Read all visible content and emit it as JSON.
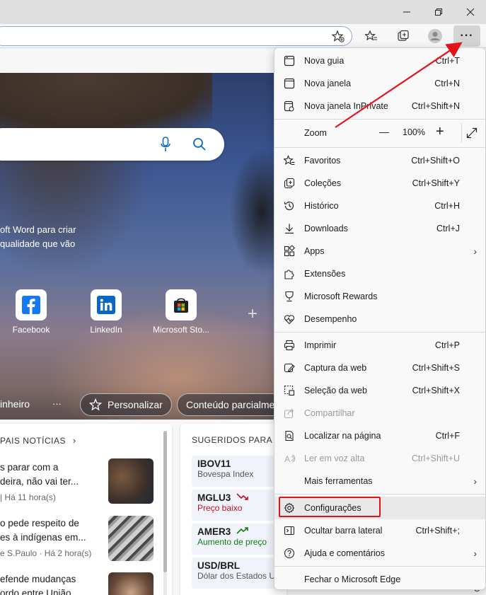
{
  "window": {
    "minimize": "—",
    "maximize": "❐",
    "close": "✕"
  },
  "page": {
    "promo_lines": [
      "oft Word para criar",
      "qualidade que vão"
    ],
    "quick_links": [
      {
        "label": "Facebook",
        "icon": "facebook-icon"
      },
      {
        "label": "LinkedIn",
        "icon": "linkedin-icon"
      },
      {
        "label": "Microsoft Sto...",
        "icon": "microsoft-store-icon"
      }
    ],
    "add_quick_link": "+",
    "feed_bar": {
      "tab_money": "inheiro",
      "ellipsis": "···",
      "personalize": "Personalizar",
      "content": "Conteúdo parcialme"
    },
    "news": {
      "header": "PAIS NOTÍCIAS",
      "items": [
        {
          "lines": [
            "s parar com a",
            "deira, não vai ter..."
          ],
          "meta": "| Há 11 hora(s)"
        },
        {
          "lines": [
            "o pede respeito de",
            "es à indígenas em..."
          ],
          "meta": "e S.Paulo · Há 2 hora(s)"
        },
        {
          "lines": [
            "efende mudanças",
            "ordo entre União..."
          ],
          "meta": ""
        }
      ]
    },
    "stocks": {
      "header": "SUGERIDOS PARA V",
      "items": [
        {
          "symbol": "IBOV11",
          "sub": "Bovespa Index",
          "trend": ""
        },
        {
          "symbol": "MGLU3",
          "sub": "Preço baixo",
          "trend": "down"
        },
        {
          "symbol": "AMER3",
          "sub": "Aumento de preço",
          "trend": "up"
        },
        {
          "symbol": "USD/BRL",
          "sub": "Dólar dos Estados U...",
          "trend": ""
        }
      ]
    }
  },
  "menu": {
    "items": [
      {
        "label": "Nova guia",
        "shortcut": "Ctrl+T"
      },
      {
        "label": "Nova janela",
        "shortcut": "Ctrl+N"
      },
      {
        "label": "Nova janela InPrivate",
        "shortcut": "Ctrl+Shift+N"
      },
      {
        "label": "Zoom",
        "zoom_value": "100%",
        "minus": "—",
        "plus": "+"
      },
      {
        "label": "Favoritos",
        "shortcut": "Ctrl+Shift+O"
      },
      {
        "label": "Coleções",
        "shortcut": "Ctrl+Shift+Y"
      },
      {
        "label": "Histórico",
        "shortcut": "Ctrl+H"
      },
      {
        "label": "Downloads",
        "shortcut": "Ctrl+J"
      },
      {
        "label": "Apps",
        "shortcut": ""
      },
      {
        "label": "Extensões",
        "shortcut": ""
      },
      {
        "label": "Microsoft Rewards",
        "shortcut": ""
      },
      {
        "label": "Desempenho",
        "shortcut": ""
      },
      {
        "label": "Imprimir",
        "shortcut": "Ctrl+P"
      },
      {
        "label": "Captura da web",
        "shortcut": "Ctrl+Shift+S"
      },
      {
        "label": "Seleção da web",
        "shortcut": "Ctrl+Shift+X"
      },
      {
        "label": "Compartilhar",
        "shortcut": ""
      },
      {
        "label": "Localizar na página",
        "shortcut": "Ctrl+F"
      },
      {
        "label": "Ler em voz alta",
        "shortcut": "Ctrl+Shift+U"
      },
      {
        "label": "Mais ferramentas",
        "shortcut": ""
      },
      {
        "label": "Configurações",
        "shortcut": ""
      },
      {
        "label": "Ocultar barra lateral",
        "shortcut": "Ctrl+Shift+;"
      },
      {
        "label": "Ajuda e comentários",
        "shortcut": ""
      },
      {
        "label": "Fechar o Microsoft Edge",
        "shortcut": ""
      }
    ]
  },
  "colors": {
    "highlight": "#e0141b",
    "accent": "#0f6cbd",
    "up": "#107c10",
    "down": "#c50f1f"
  }
}
